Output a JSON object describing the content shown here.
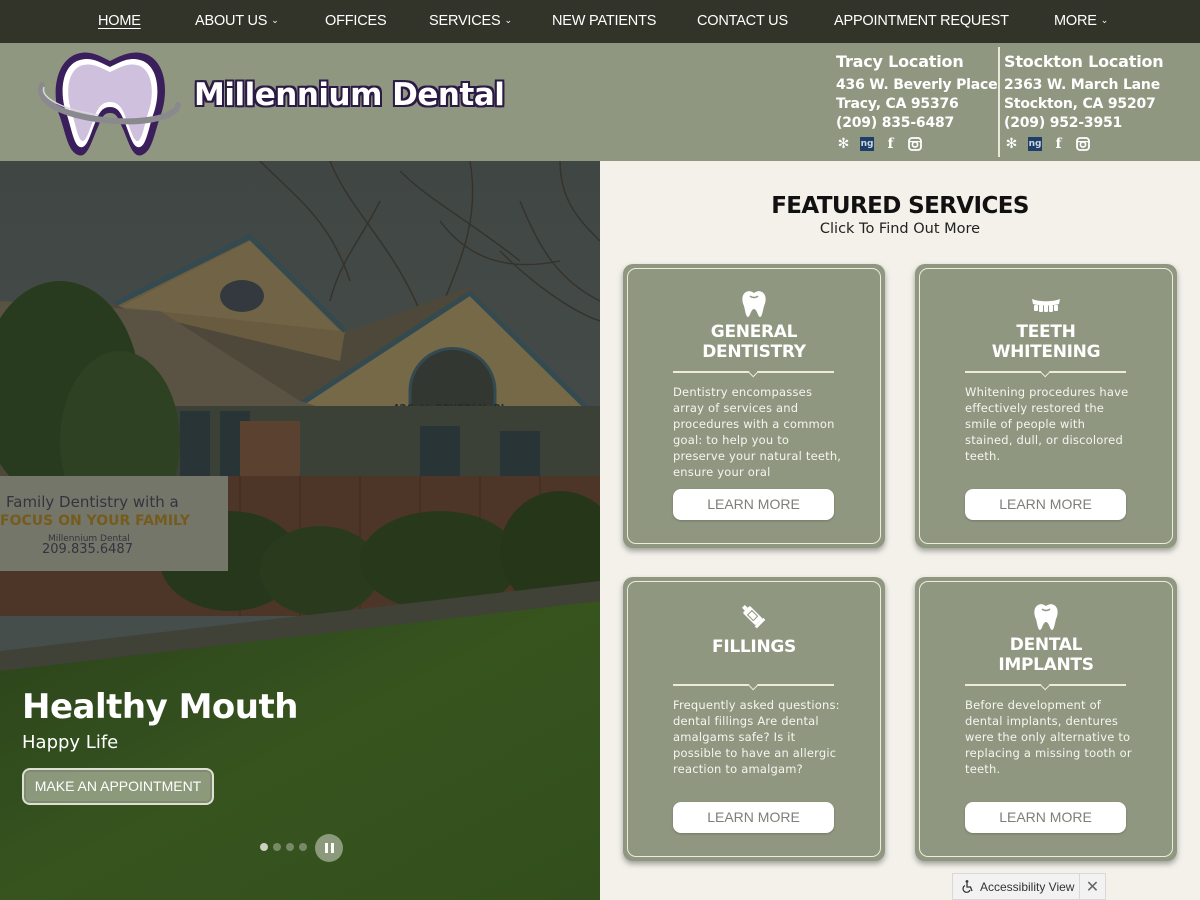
{
  "nav": {
    "items": [
      {
        "label": "HOME",
        "active": true,
        "dropdown": false
      },
      {
        "label": "ABOUT US",
        "active": false,
        "dropdown": true
      },
      {
        "label": "OFFICES",
        "active": false,
        "dropdown": false
      },
      {
        "label": "SERVICES",
        "active": false,
        "dropdown": true
      },
      {
        "label": "NEW PATIENTS",
        "active": false,
        "dropdown": false
      },
      {
        "label": "CONTACT US",
        "active": false,
        "dropdown": false
      },
      {
        "label": "APPOINTMENT REQUEST",
        "active": false,
        "dropdown": false
      },
      {
        "label": "MORE",
        "active": false,
        "dropdown": true
      }
    ],
    "chevron": "⌄"
  },
  "header": {
    "brand": "Millennium Dental",
    "locations": [
      {
        "title": "Tracy Location",
        "address1": "436 W. Beverly Place",
        "address2": "Tracy, CA 95376",
        "phone": "(209) 835-6487",
        "social": [
          "yelp-icon",
          "ng-icon",
          "facebook-icon",
          "instagram-icon"
        ]
      },
      {
        "title": "Stockton Location",
        "address1": "2363 W. March Lane",
        "address2": "Stockton, CA 95207",
        "phone": "(209) 952-3951",
        "social": [
          "yelp-icon",
          "ng-icon",
          "facebook-icon",
          "instagram-icon"
        ]
      }
    ]
  },
  "hero": {
    "title": "Healthy Mouth",
    "subtitle": "Happy Life",
    "cta": "MAKE AN APPOINTMENT",
    "banner": {
      "line1": "Family Dentistry with a",
      "line2": "FOCUS ON YOUR FAMILY",
      "line3": "Millennium Dental",
      "line4": "209.835.6487"
    },
    "building_sign": "436 W BEVERLY PL",
    "slides": 4,
    "active_slide": 1
  },
  "featured": {
    "title": "FEATURED SERVICES",
    "subtitle": "Click To Find Out More",
    "cards": [
      {
        "icon": "tooth-icon",
        "title_line1": "GENERAL",
        "title_line2": "DENTISTRY",
        "description": "Dentistry encompasses array of services and procedures with a common goal: to help you to preserve your natural teeth, ensure your oral",
        "button": "LEARN MORE"
      },
      {
        "icon": "teeth-row-icon",
        "title_line1": "TEETH",
        "title_line2": "WHITENING",
        "description": "Whitening procedures have effectively restored the smile of people with stained, dull, or discolored teeth.",
        "button": "LEARN MORE"
      },
      {
        "icon": "filling-tube-icon",
        "title_line1": "FILLINGS",
        "title_line2": "",
        "description": "Frequently asked questions: dental fillings Are dental amalgams safe? Is it possible to have an allergic reaction to amalgam?",
        "button": "LEARN MORE"
      },
      {
        "icon": "tooth-icon",
        "title_line1": "DENTAL",
        "title_line2": "IMPLANTS",
        "description": "Before development of dental implants, dentures were the only alternative to replacing a missing tooth or teeth.",
        "button": "LEARN MORE"
      }
    ]
  },
  "accessibility": {
    "label": "Accessibility View",
    "icon": "wheelchair-icon",
    "close": "✕"
  },
  "colors": {
    "nav_bg": "#32342a",
    "header_bg": "#8f9780",
    "card_bg": "#8f9780",
    "page_bg": "#f3f1ea",
    "logo_purple": "#3a1f5c",
    "logo_lavender": "#cfc0de"
  }
}
